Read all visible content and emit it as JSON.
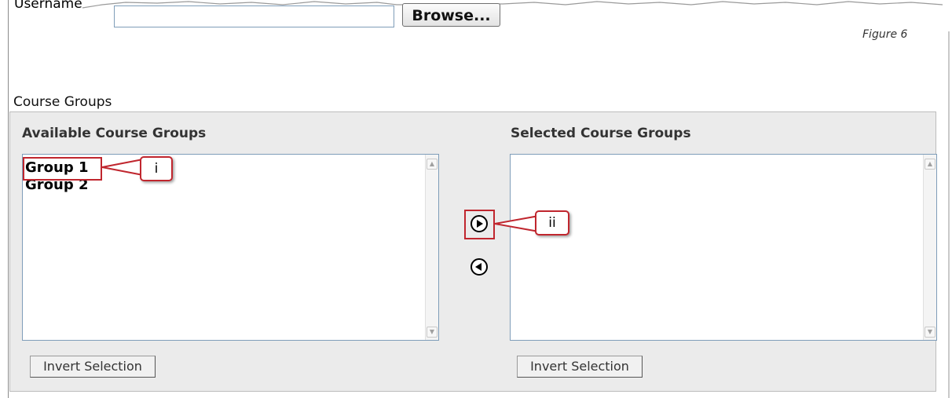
{
  "top_form": {
    "username_label": "Username",
    "username_value": "",
    "browse_label": "Browse..."
  },
  "figure_caption": "Figure 6",
  "course_groups": {
    "section_title": "Course Groups",
    "available": {
      "heading": "Available Course Groups",
      "items": [
        "Group 1",
        "Group 2"
      ],
      "invert_label": "Invert Selection"
    },
    "selected": {
      "heading": "Selected Course Groups",
      "items": [],
      "invert_label": "Invert Selection"
    },
    "move_right_icon": "circle-arrow-right-icon",
    "move_left_icon": "circle-arrow-left-icon"
  },
  "annotations": {
    "callout_i": "i",
    "callout_ii": "ii",
    "highlight_color": "#c0262e"
  },
  "colors": {
    "panel_bg": "#ebebeb",
    "listbox_border": "#7f9db9"
  }
}
